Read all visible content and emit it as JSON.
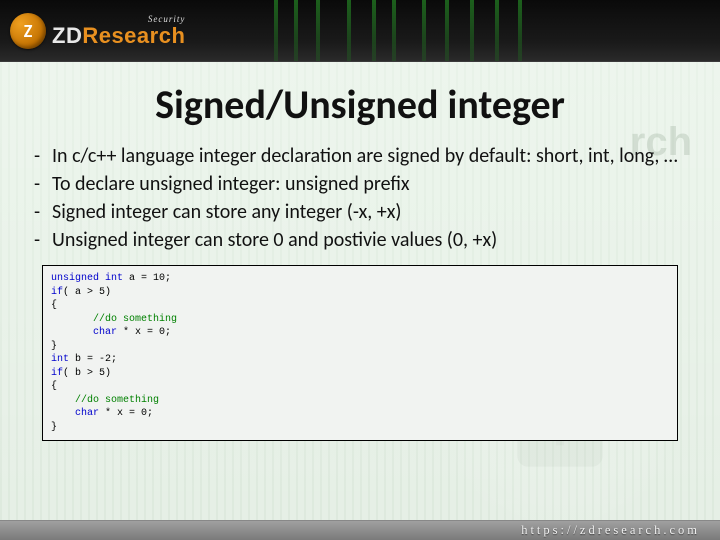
{
  "header": {
    "logo_letter": "Z",
    "logo_security": "Security",
    "logo_main_pre": "ZD",
    "logo_main_post": "Research"
  },
  "title": "Signed/Unsigned integer",
  "watermark": "rch",
  "bullets": [
    "In c/c++ language integer declaration are signed by default: short, int, long, …",
    "To declare unsigned integer: unsigned prefix",
    "Signed integer can store any integer (-x, +x)",
    "Unsigned integer can store 0 and postivie values (0, +x)"
  ],
  "code": {
    "l1_kw": "unsigned int",
    "l1_rest": " a = 10;",
    "l2_kw": "if",
    "l2_rest": "( a > 5)",
    "l3": "{",
    "l4_indent": "       ",
    "l4_cmt": "//do something",
    "l5_indent": "       ",
    "l5_kw": "char",
    "l5_rest": " * x = 0;",
    "l6": "}",
    "l7_kw": "int",
    "l7_rest": " b = -2;",
    "l8_kw": "if",
    "l8_rest": "( b > 5)",
    "l9": "{",
    "l10_indent": "    ",
    "l10_cmt": "//do something",
    "l11_indent": "    ",
    "l11_kw": "char",
    "l11_rest": " * x = 0;",
    "l12": "}"
  },
  "footer": {
    "url": "https://zdresearch.com"
  }
}
